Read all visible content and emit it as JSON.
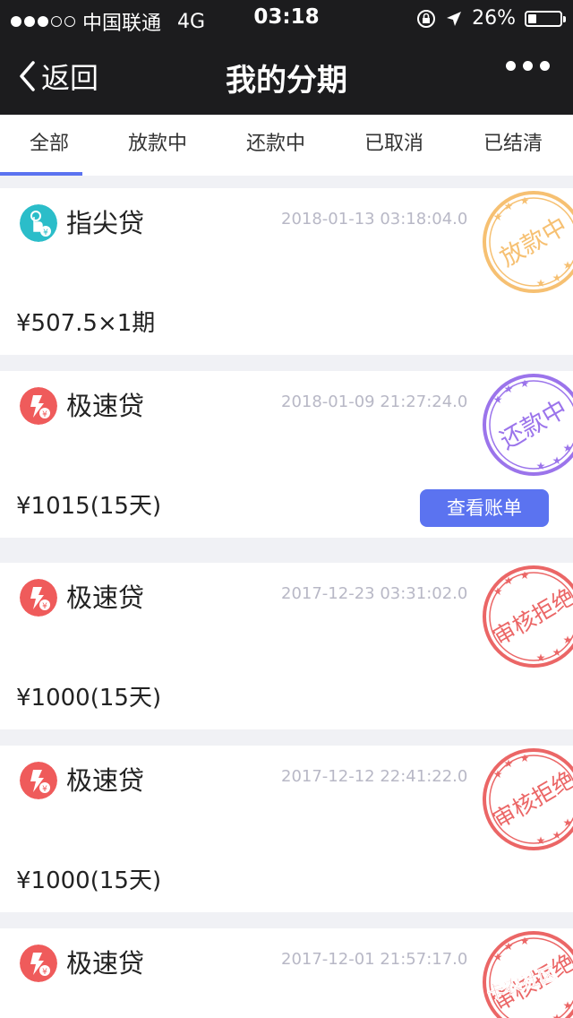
{
  "status_bar": {
    "carrier": "中国联通",
    "network": "4G",
    "time": "03:18",
    "battery": "26%",
    "battery_level": 0.26
  },
  "nav": {
    "back_label": "返回",
    "title": "我的分期"
  },
  "tabs": [
    {
      "label": "全部"
    },
    {
      "label": "放款中"
    },
    {
      "label": "还款中"
    },
    {
      "label": "已取消"
    },
    {
      "label": "已结清"
    }
  ],
  "loans": [
    {
      "product": "指尖贷",
      "date": "2018-01-13 03:18:04.0",
      "amount": "¥507.5×1期",
      "status": "放款中",
      "stamp_color": "#f5b65a",
      "logo_color": "#2bbdc9",
      "icon": "finger-tap-icon"
    },
    {
      "product": "极速贷",
      "date": "2018-01-09 21:27:24.0",
      "amount": "¥1015(15天)",
      "status": "还款中",
      "stamp_color": "#8a5ce8",
      "logo_color": "#ef5b5b",
      "icon": "lightning-yen-icon",
      "action": "查看账单"
    },
    {
      "product": "极速贷",
      "date": "2017-12-23 03:31:02.0",
      "amount": "¥1000(15天)",
      "status": "审核拒绝",
      "stamp_color": "#e84c4c",
      "logo_color": "#ef5b5b",
      "icon": "lightning-yen-icon"
    },
    {
      "product": "极速贷",
      "date": "2017-12-12 22:41:22.0",
      "amount": "¥1000(15天)",
      "status": "审核拒绝",
      "stamp_color": "#e84c4c",
      "logo_color": "#ef5b5b",
      "icon": "lightning-yen-icon"
    },
    {
      "product": "极速贷",
      "date": "2017-12-01 21:57:17.0",
      "amount": "",
      "status": "审核拒绝",
      "stamp_color": "#e84c4c",
      "logo_color": "#ef5b5b",
      "icon": "lightning-yen-icon"
    }
  ],
  "watermark": "卡农社区",
  "colors": {
    "accent": "#5b73f0",
    "nav_bg": "#1c1c1e"
  }
}
